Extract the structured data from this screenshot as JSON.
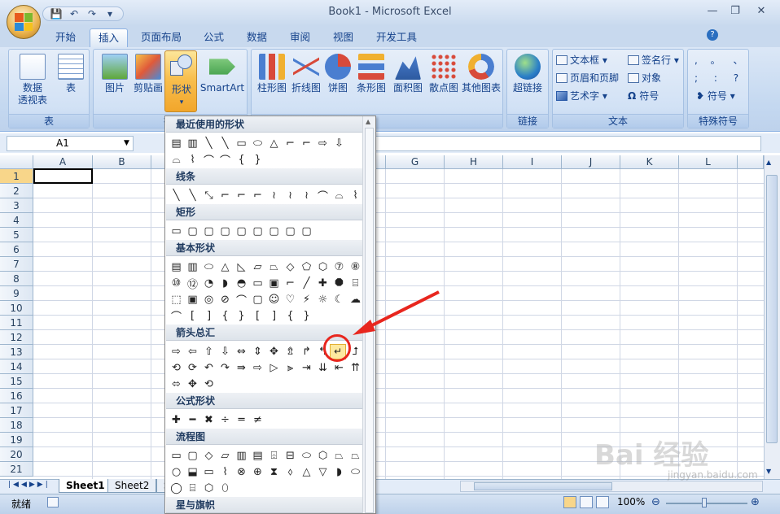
{
  "window": {
    "title": "Book1 - Microsoft Excel",
    "minimize": "—",
    "restore": "❐",
    "close": "✕"
  },
  "qat": {
    "save": "💾",
    "undo": "↶",
    "redo": "↷",
    "more": "▾"
  },
  "tabs": [
    {
      "label": "开始"
    },
    {
      "label": "插入"
    },
    {
      "label": "页面布局"
    },
    {
      "label": "公式"
    },
    {
      "label": "数据"
    },
    {
      "label": "审阅"
    },
    {
      "label": "视图"
    },
    {
      "label": "开发工具"
    }
  ],
  "ribbon": {
    "tables_group": {
      "label": "表",
      "pivot": "数据\n透视表",
      "table": "表"
    },
    "illustrations_group": {
      "label": "插",
      "picture": "图片",
      "clipart": "剪贴画",
      "shapes": "形状",
      "smartart": "SmartArt"
    },
    "charts_group": {
      "label": "图表",
      "column": "柱形图",
      "line": "折线图",
      "pie": "饼图",
      "bar": "条形图",
      "area": "面积图",
      "scatter": "散点图",
      "other": "其他图表"
    },
    "links_group": {
      "label": "链接",
      "hyperlink": "超链接"
    },
    "text_group": {
      "label": "文本",
      "textbox": "文本框",
      "header_footer": "页眉和页脚",
      "wordart": "艺术字",
      "signature": "签名行",
      "object": "对象",
      "symbol": "符号"
    },
    "special_group": {
      "label": "特殊符号",
      "symbols_row1": ", 。 、",
      "symbols_row2": "; : ?",
      "symbol": "符号"
    }
  },
  "formula": {
    "namebox": "A1",
    "fx": "fx"
  },
  "columns": [
    "A",
    "B",
    "C",
    "D",
    "E",
    "F",
    "G",
    "H",
    "I",
    "J",
    "K",
    "L"
  ],
  "rows": [
    "1",
    "2",
    "3",
    "4",
    "5",
    "6",
    "7",
    "8",
    "9",
    "10",
    "11",
    "12",
    "13",
    "14",
    "15",
    "16",
    "17",
    "18",
    "19",
    "20",
    "21"
  ],
  "sheets": {
    "tab1": "Sheet1",
    "tab2": "Sheet2",
    "tab3": "S"
  },
  "status": {
    "ready": "就绪",
    "zoom": "100%"
  },
  "gallery": {
    "categories": {
      "recent": "最近使用的形状",
      "lines": "线条",
      "rect": "矩形",
      "basic": "基本形状",
      "arrows": "箭头总汇",
      "equation": "公式形状",
      "flowchart": "流程图",
      "stars": "星与旗帜"
    },
    "recent_r1": "▤ ▥ ╲ ╲ ▭ ⬭ △ ⌐ ⌐ ⇨ ⇩",
    "recent_r2": "⌓ ⌇ ⌒ ⌒ { }",
    "lines_r1": "╲ ╲ ⤡ ⌐ ⌐ ⌐ ≀ ≀ ≀ ⌒ ⌓ ⌇",
    "rect_r1": "▭ ▢ ▢ ▢ ▢ ▢ ▢ ▢ ▢",
    "basic_r1": "▤ ▥ ⬭ △ ◺ ▱ ⏢ ◇ ⬠ ⬡ ⑦ ⑧",
    "basic_r2": "⑩ ⑫ ◔ ◗ ◓ ▭ ▣ ⌐ ╱ ✚ ⯃ ⌸",
    "basic_r3": "⬚ ▣ ◎ ⊘ ⌒ ▢ ☺ ♡ ⚡ ☼ ☾ ☁",
    "basic_r4": "⌒ [ ] { } [ ] { }",
    "arrows_r1": "⇨ ⇦ ⇧ ⇩ ⇔ ⇕ ✥ ⇯ ↱ ↰ ↵ ⮥",
    "arrows_r2": "⟲ ⟳ ↶ ↷ ⇛ ⇨ ▷ ⫸ ⇥ ⇊ ⇤ ⇈",
    "arrows_r3": "⬄ ✥ ⟲",
    "eq_r1": "✚ ━ ✖ ÷ ═ ≠",
    "flow_r1": "▭ ▢ ◇ ▱ ▥ ▤ ⌹ ⊟ ⬭ ⬡ ⏢ ⏢",
    "flow_r2": "○ ⬓ ▭ ⌇ ⊗ ⊕ ⧗ ⬨ △ ▽ ◗ ⬭",
    "flow_r3": "◯ ⌸ ⬡ ⬯"
  },
  "watermark": {
    "brand": "Bai 经验",
    "url": "jingyan.baidu.com"
  }
}
